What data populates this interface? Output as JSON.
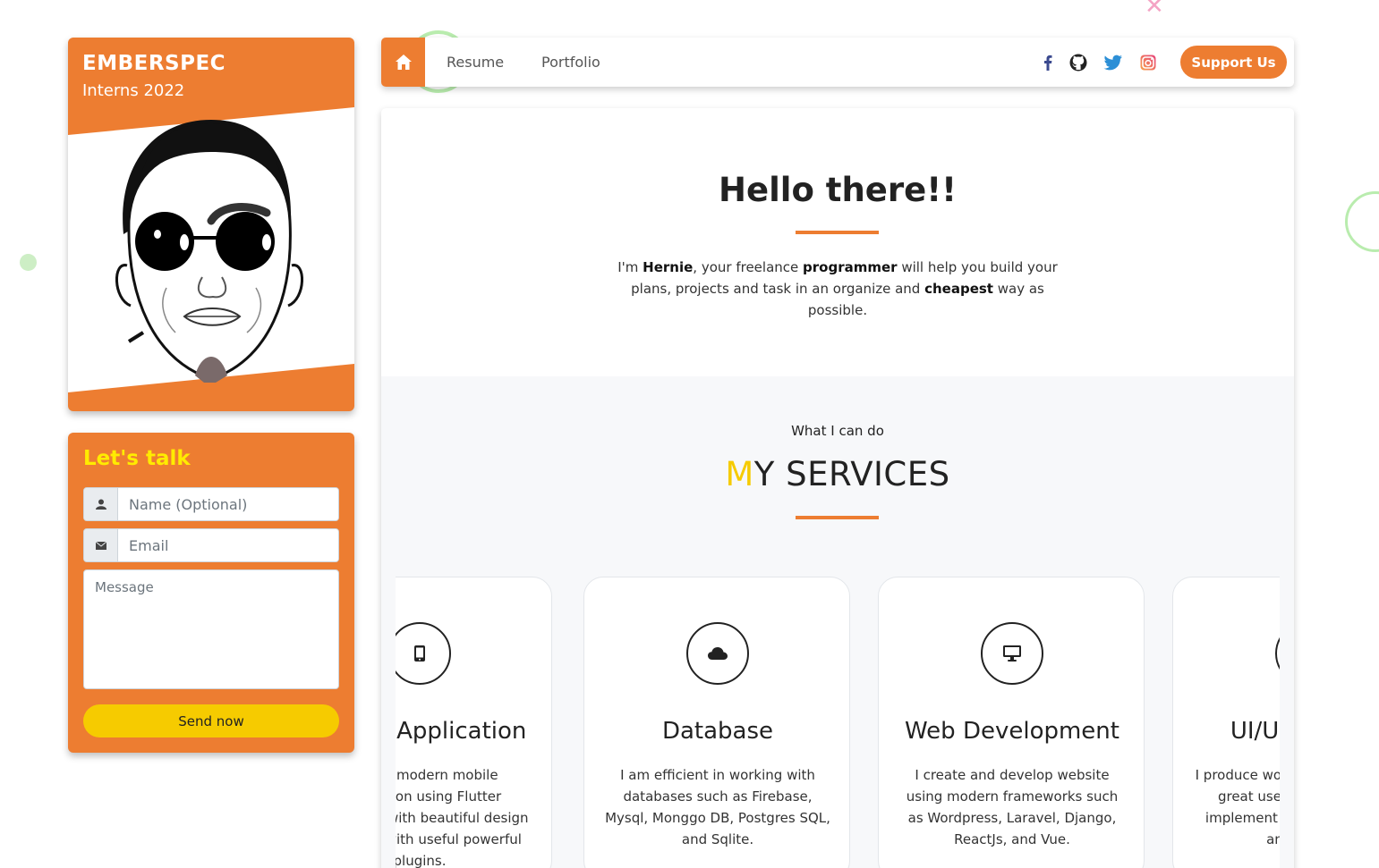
{
  "brand": {
    "name": "EMBERSPEC",
    "subtitle": "Interns 2022"
  },
  "contact": {
    "title": "Let's talk",
    "name_placeholder": "Name (Optional)",
    "email_placeholder": "Email",
    "message_placeholder": "Message",
    "send_label": "Send now"
  },
  "nav": {
    "links": [
      {
        "label": "Resume"
      },
      {
        "label": "Portfolio"
      }
    ],
    "support_label": "Support Us",
    "social_icons": [
      "facebook-icon",
      "github-icon",
      "twitter-icon",
      "instagram-icon"
    ]
  },
  "hero": {
    "title": "Hello there!!",
    "intro_prefix": "I'm ",
    "name": "Hernie",
    "mid1": ", your freelance ",
    "role": "programmer",
    "mid2": " will help you build your plans, projects and task in an organize and ",
    "emphasis": "cheapest",
    "suffix": " way as possible."
  },
  "services": {
    "kicker": "What I can do",
    "title_first": "M",
    "title_rest": "Y SERVICES",
    "cards": [
      {
        "icon": "mobile-icon",
        "title": "Mobile Application",
        "desc": "I create modern mobile application using Flutter framework with beautiful design embeded with useful powerful plugins."
      },
      {
        "icon": "cloud-icon",
        "title": "Database",
        "desc": "I am efficient in working with databases such as Firebase, Mysql, Monggo DB, Postgres SQL, and Sqlite."
      },
      {
        "icon": "desktop-icon",
        "title": "Web Development",
        "desc": "I create and develop website using modern frameworks such as Wordpress, Laravel, Django, ReactJs, and Vue."
      },
      {
        "icon": "design-icon",
        "title": "UI/UX Design",
        "desc": "I produce wonderful designs with great user experience and implement them in my design and project."
      }
    ]
  },
  "colors": {
    "accent": "#ed7d31",
    "yellow": "#f6cb00",
    "contact_title": "#ffeb00"
  }
}
